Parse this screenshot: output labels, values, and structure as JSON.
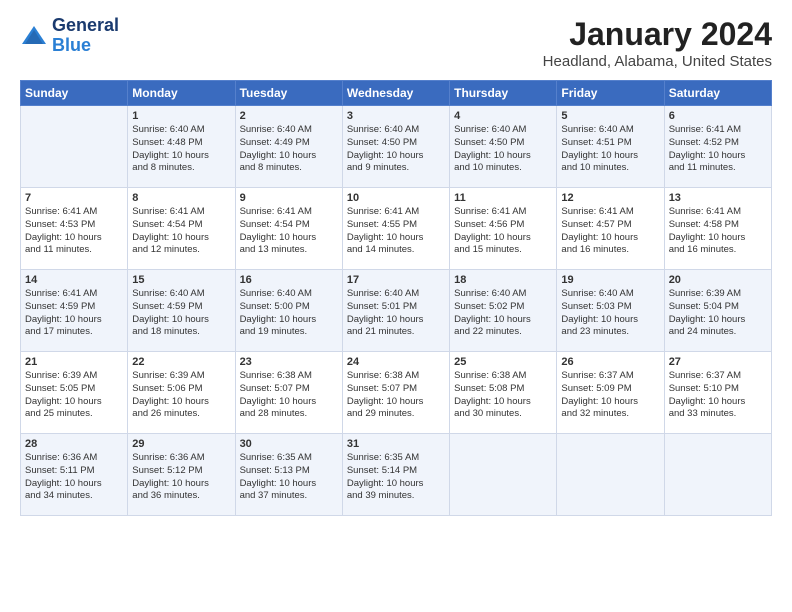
{
  "header": {
    "logo_text_general": "General",
    "logo_text_blue": "Blue",
    "title": "January 2024",
    "subtitle": "Headland, Alabama, United States"
  },
  "columns": [
    "Sunday",
    "Monday",
    "Tuesday",
    "Wednesday",
    "Thursday",
    "Friday",
    "Saturday"
  ],
  "rows": [
    [
      {
        "num": "",
        "info": ""
      },
      {
        "num": "1",
        "info": "Sunrise: 6:40 AM\nSunset: 4:48 PM\nDaylight: 10 hours\nand 8 minutes."
      },
      {
        "num": "2",
        "info": "Sunrise: 6:40 AM\nSunset: 4:49 PM\nDaylight: 10 hours\nand 8 minutes."
      },
      {
        "num": "3",
        "info": "Sunrise: 6:40 AM\nSunset: 4:50 PM\nDaylight: 10 hours\nand 9 minutes."
      },
      {
        "num": "4",
        "info": "Sunrise: 6:40 AM\nSunset: 4:50 PM\nDaylight: 10 hours\nand 10 minutes."
      },
      {
        "num": "5",
        "info": "Sunrise: 6:40 AM\nSunset: 4:51 PM\nDaylight: 10 hours\nand 10 minutes."
      },
      {
        "num": "6",
        "info": "Sunrise: 6:41 AM\nSunset: 4:52 PM\nDaylight: 10 hours\nand 11 minutes."
      }
    ],
    [
      {
        "num": "7",
        "info": "Sunrise: 6:41 AM\nSunset: 4:53 PM\nDaylight: 10 hours\nand 11 minutes."
      },
      {
        "num": "8",
        "info": "Sunrise: 6:41 AM\nSunset: 4:54 PM\nDaylight: 10 hours\nand 12 minutes."
      },
      {
        "num": "9",
        "info": "Sunrise: 6:41 AM\nSunset: 4:54 PM\nDaylight: 10 hours\nand 13 minutes."
      },
      {
        "num": "10",
        "info": "Sunrise: 6:41 AM\nSunset: 4:55 PM\nDaylight: 10 hours\nand 14 minutes."
      },
      {
        "num": "11",
        "info": "Sunrise: 6:41 AM\nSunset: 4:56 PM\nDaylight: 10 hours\nand 15 minutes."
      },
      {
        "num": "12",
        "info": "Sunrise: 6:41 AM\nSunset: 4:57 PM\nDaylight: 10 hours\nand 16 minutes."
      },
      {
        "num": "13",
        "info": "Sunrise: 6:41 AM\nSunset: 4:58 PM\nDaylight: 10 hours\nand 16 minutes."
      }
    ],
    [
      {
        "num": "14",
        "info": "Sunrise: 6:41 AM\nSunset: 4:59 PM\nDaylight: 10 hours\nand 17 minutes."
      },
      {
        "num": "15",
        "info": "Sunrise: 6:40 AM\nSunset: 4:59 PM\nDaylight: 10 hours\nand 18 minutes."
      },
      {
        "num": "16",
        "info": "Sunrise: 6:40 AM\nSunset: 5:00 PM\nDaylight: 10 hours\nand 19 minutes."
      },
      {
        "num": "17",
        "info": "Sunrise: 6:40 AM\nSunset: 5:01 PM\nDaylight: 10 hours\nand 21 minutes."
      },
      {
        "num": "18",
        "info": "Sunrise: 6:40 AM\nSunset: 5:02 PM\nDaylight: 10 hours\nand 22 minutes."
      },
      {
        "num": "19",
        "info": "Sunrise: 6:40 AM\nSunset: 5:03 PM\nDaylight: 10 hours\nand 23 minutes."
      },
      {
        "num": "20",
        "info": "Sunrise: 6:39 AM\nSunset: 5:04 PM\nDaylight: 10 hours\nand 24 minutes."
      }
    ],
    [
      {
        "num": "21",
        "info": "Sunrise: 6:39 AM\nSunset: 5:05 PM\nDaylight: 10 hours\nand 25 minutes."
      },
      {
        "num": "22",
        "info": "Sunrise: 6:39 AM\nSunset: 5:06 PM\nDaylight: 10 hours\nand 26 minutes."
      },
      {
        "num": "23",
        "info": "Sunrise: 6:38 AM\nSunset: 5:07 PM\nDaylight: 10 hours\nand 28 minutes."
      },
      {
        "num": "24",
        "info": "Sunrise: 6:38 AM\nSunset: 5:07 PM\nDaylight: 10 hours\nand 29 minutes."
      },
      {
        "num": "25",
        "info": "Sunrise: 6:38 AM\nSunset: 5:08 PM\nDaylight: 10 hours\nand 30 minutes."
      },
      {
        "num": "26",
        "info": "Sunrise: 6:37 AM\nSunset: 5:09 PM\nDaylight: 10 hours\nand 32 minutes."
      },
      {
        "num": "27",
        "info": "Sunrise: 6:37 AM\nSunset: 5:10 PM\nDaylight: 10 hours\nand 33 minutes."
      }
    ],
    [
      {
        "num": "28",
        "info": "Sunrise: 6:36 AM\nSunset: 5:11 PM\nDaylight: 10 hours\nand 34 minutes."
      },
      {
        "num": "29",
        "info": "Sunrise: 6:36 AM\nSunset: 5:12 PM\nDaylight: 10 hours\nand 36 minutes."
      },
      {
        "num": "30",
        "info": "Sunrise: 6:35 AM\nSunset: 5:13 PM\nDaylight: 10 hours\nand 37 minutes."
      },
      {
        "num": "31",
        "info": "Sunrise: 6:35 AM\nSunset: 5:14 PM\nDaylight: 10 hours\nand 39 minutes."
      },
      {
        "num": "",
        "info": ""
      },
      {
        "num": "",
        "info": ""
      },
      {
        "num": "",
        "info": ""
      }
    ]
  ]
}
